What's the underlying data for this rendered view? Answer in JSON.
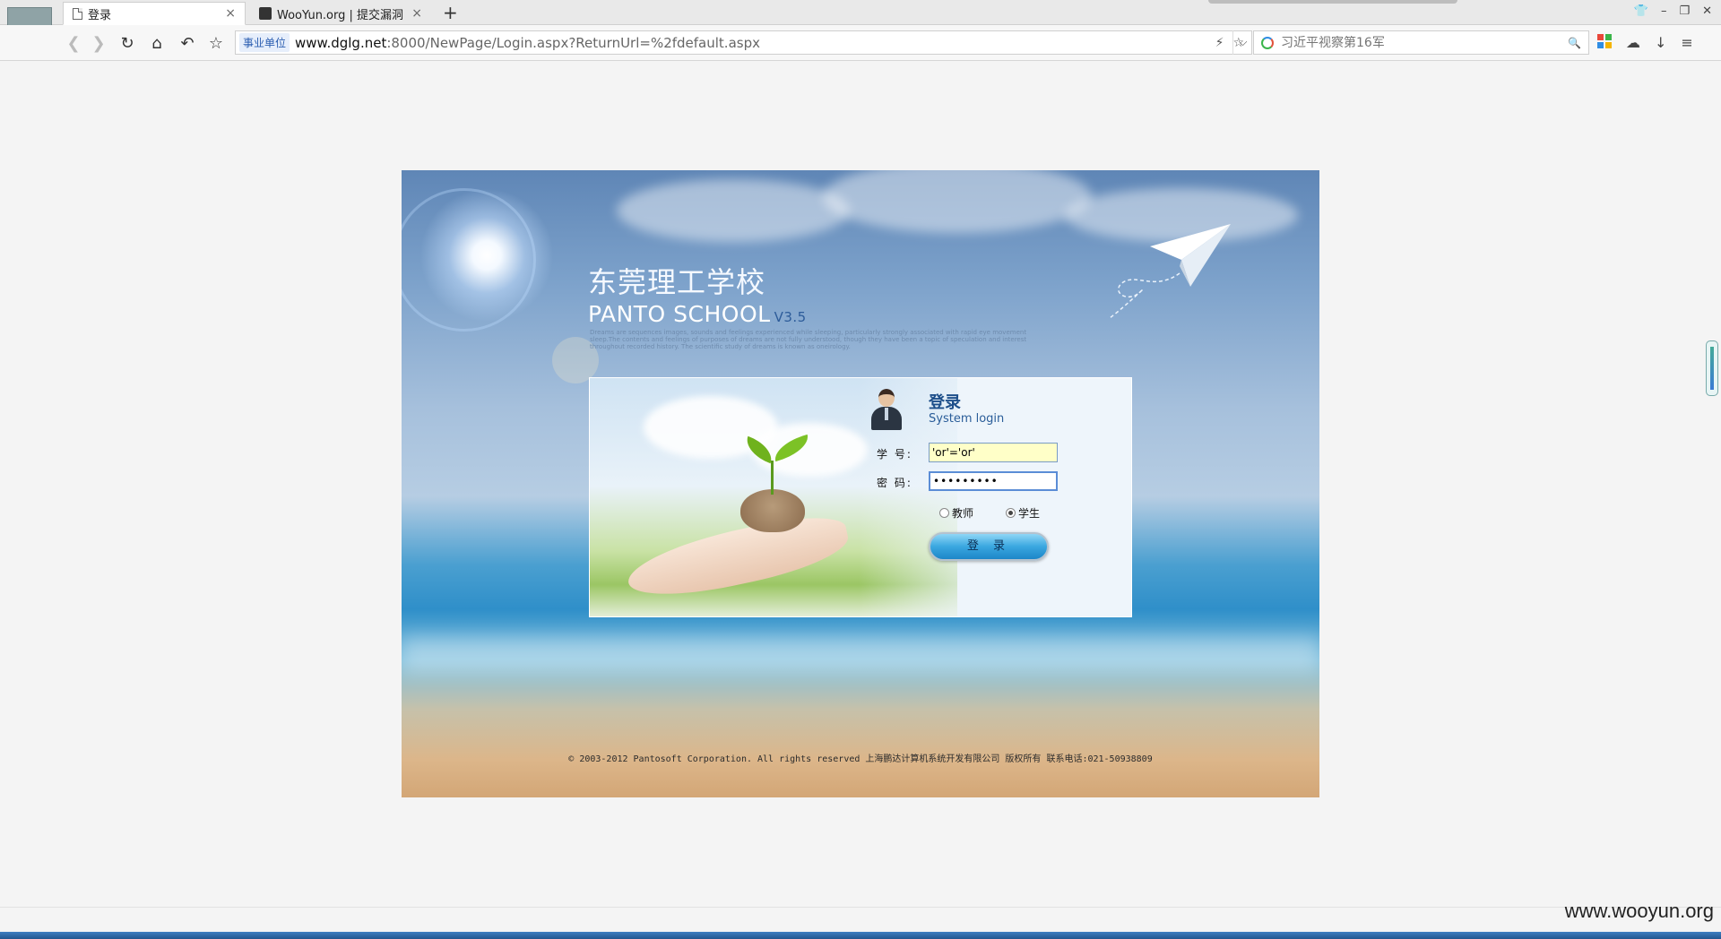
{
  "browser": {
    "tabs": [
      {
        "label": "登录",
        "icon": "page-icon",
        "active": true
      },
      {
        "label": "WooYun.org | 提交漏洞",
        "icon": "wooyun-icon",
        "active": false
      }
    ],
    "new_tab": "+",
    "address": {
      "badge": "事业单位",
      "host": "www.dglg.net",
      "path": ":8000/NewPage/Login.aspx?ReturnUrl=%2fdefault.aspx"
    },
    "search_placeholder": "习近平视察第16军"
  },
  "page": {
    "school_name": "东莞理工学校",
    "product": "PANTO SCHOOL",
    "version": "V3.5",
    "tagline": "Dreams are sequences images, sounds and feelings experienced while sleeping, particularly strongly associated with rapid eye movement sleep.The contents and feelings of purposes of dreams are not fully understood, though they have been a topic of speculation and interest throughout recorded history. The scientific study of dreams is known as oneirology.",
    "login": {
      "title": "登录",
      "subtitle": "System login",
      "student_id_label": "学  号:",
      "student_id_value": "'or'='or'",
      "password_label": "密  码:",
      "password_value": "•••••••••",
      "role_options": [
        "教师",
        "学生"
      ],
      "role_selected": "学生",
      "submit_label": "登 录"
    },
    "footer": "© 2003-2012 Pantosoft Corporation. All rights reserved 上海鹏达计算机系统开发有限公司 版权所有 联系电话:021-50938809"
  },
  "watermark": "www.wooyun.org",
  "colors": {
    "brand_blue": "#1d4f8a",
    "button_blue": "#3aa7e0",
    "sid_field_bg": "#ffffc8"
  }
}
